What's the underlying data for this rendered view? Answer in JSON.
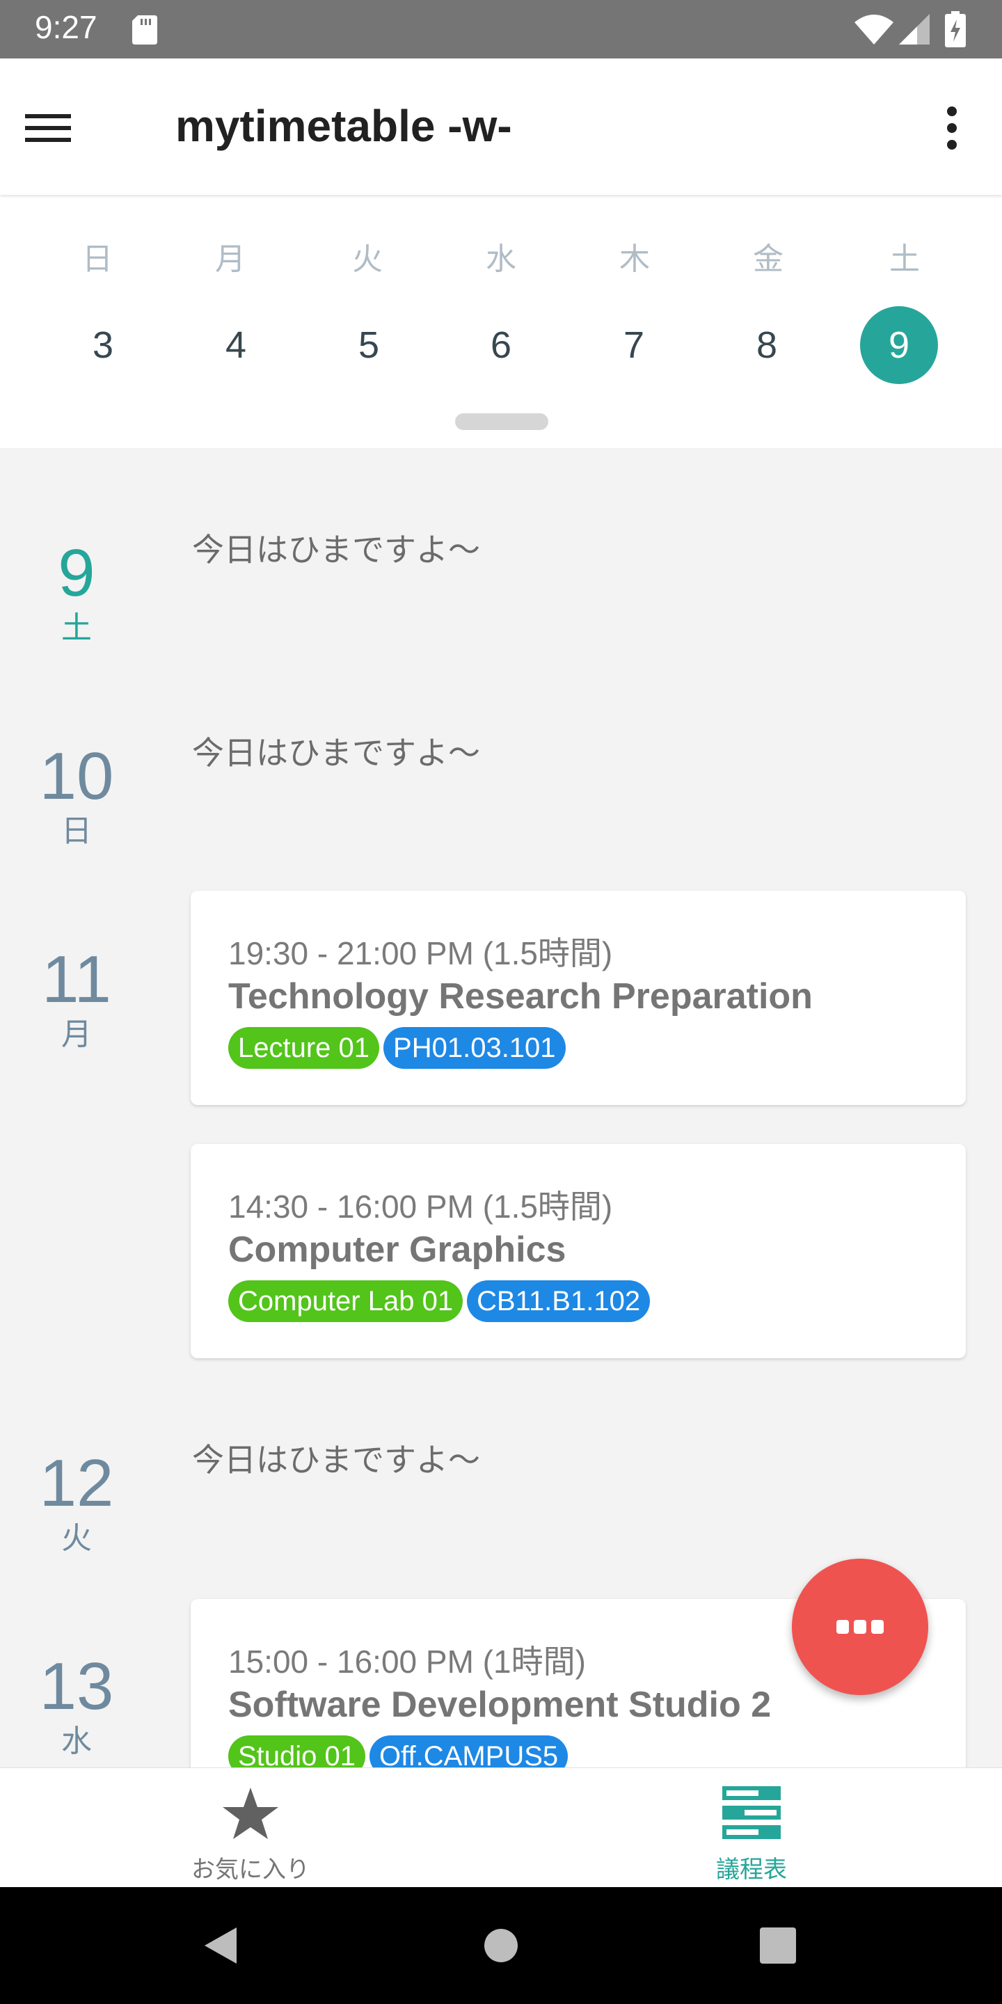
{
  "status_bar": {
    "time": "9:27"
  },
  "app_bar": {
    "title": "mytimetable -w-"
  },
  "week": {
    "weekdays": [
      "日",
      "月",
      "火",
      "水",
      "木",
      "金",
      "土"
    ],
    "days": [
      "3",
      "4",
      "5",
      "6",
      "7",
      "8",
      "9"
    ],
    "selected_index": 6
  },
  "agenda": {
    "days": [
      {
        "date": "9",
        "dow": "土",
        "empty_text": "今日はひまですよ〜"
      },
      {
        "date": "10",
        "dow": "日",
        "empty_text": "今日はひまですよ〜"
      },
      {
        "date": "11",
        "dow": "月",
        "events": [
          {
            "time": "19:30 - 21:00 PM (1.5時間)",
            "title": "Technology Research Preparation",
            "tags": [
              "Lecture 01",
              "PH01.03.101"
            ]
          },
          {
            "time": "14:30 - 16:00 PM (1.5時間)",
            "title": "Computer Graphics",
            "tags": [
              "Computer Lab 01",
              "CB11.B1.102"
            ]
          }
        ]
      },
      {
        "date": "12",
        "dow": "火",
        "empty_text": "今日はひまですよ〜"
      },
      {
        "date": "13",
        "dow": "水",
        "events": [
          {
            "time": "15:00 - 16:00 PM (1時間)",
            "title": "Software Development Studio 2",
            "tags": [
              "Studio 01",
              "Off.CAMPUS5"
            ]
          }
        ]
      }
    ]
  },
  "bottom_nav": {
    "favorites_label": "お気に入り",
    "schedule_label": "議程表"
  },
  "colors": {
    "accent": "#26a69a",
    "fab": "#ef5350",
    "tag_type": "#52c41a",
    "tag_room": "#1e88e5"
  },
  "icons": {
    "menu": "hamburger-menu-icon",
    "more": "more-vert-icon",
    "fab": "more-horiz-icon",
    "favorites": "star-icon",
    "schedule": "view-agenda-icon"
  }
}
